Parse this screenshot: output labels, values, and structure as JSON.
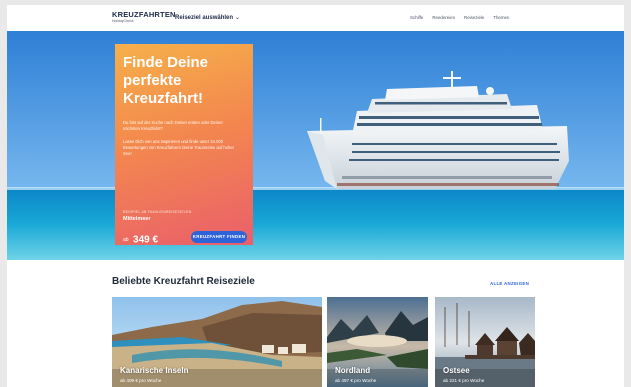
{
  "header": {
    "logo": "KREUZFAHRTEN",
    "logo_sub": "HolidayCheck",
    "destination_select": "Reiseziel auswählen",
    "nav": [
      "Schiffe",
      "Reedereien",
      "Reiseziele",
      "Themen"
    ]
  },
  "hero": {
    "title": "Finde Deine perfekte Kreuzfahrt!",
    "text1": "Du bist auf der Suche nach Deiner ersten oder Deiner nächsten Kreuzfahrt?",
    "text2": "Lasse Dich von uns inspirieren und finde unter 34.000 Bewertungen von Kreuzfahrern Deine Traumreise auf hoher See!",
    "small_label": "BEISPIEL AB FAMILIENREISEZIELEN",
    "destination": "Mittelmeer",
    "price_prefix": "ab",
    "price": "349 €",
    "cta": "KREUZFAHRT FINDEN"
  },
  "section": {
    "title": "Beliebte Kreuzfahrt Reiseziele",
    "all_link": "ALLE ANZEIGEN"
  },
  "cards": [
    {
      "name": "Kanarische Inseln",
      "price": "ab 409 € pro Woche"
    },
    {
      "name": "Nordland",
      "price": "ab 497 € pro Woche"
    },
    {
      "name": "Ostsee",
      "price": "ab 221 € pro Woche"
    }
  ],
  "colors": {
    "accent": "#2f63d8",
    "card_gradient_top": "#f6b04a",
    "card_gradient_bottom": "#ea5f6a",
    "heading": "#1e2a3a"
  }
}
